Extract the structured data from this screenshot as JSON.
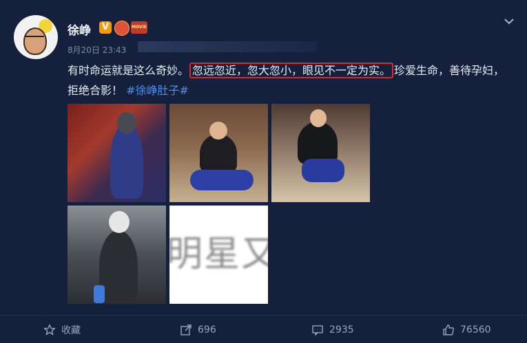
{
  "post": {
    "author": "徐峥",
    "timestamp": "8月20日 23:43",
    "text_before": "有时命运就是这么奇妙。",
    "text_highlight": "忽远忽近，忽大忽小，眼见不一定为实。",
    "text_after": "珍爱生命，善待孕妇，拒绝合影！",
    "hashtag": "#徐峥肚子#",
    "badges": [
      "V",
      "crown",
      "MOVIE"
    ],
    "watermark_text": "明星又"
  },
  "actions": {
    "favorite_label": "收藏",
    "repost_count": "696",
    "comment_count": "2935",
    "like_count": "76560"
  },
  "icons": {
    "menu": "chevron-down-icon",
    "favorite": "star-icon",
    "repost": "share-icon",
    "comment": "comment-icon",
    "like": "thumbs-up-icon"
  },
  "colors": {
    "background": "#15203c",
    "highlight_border": "#e0262e",
    "hashtag": "#4f8ff7"
  }
}
